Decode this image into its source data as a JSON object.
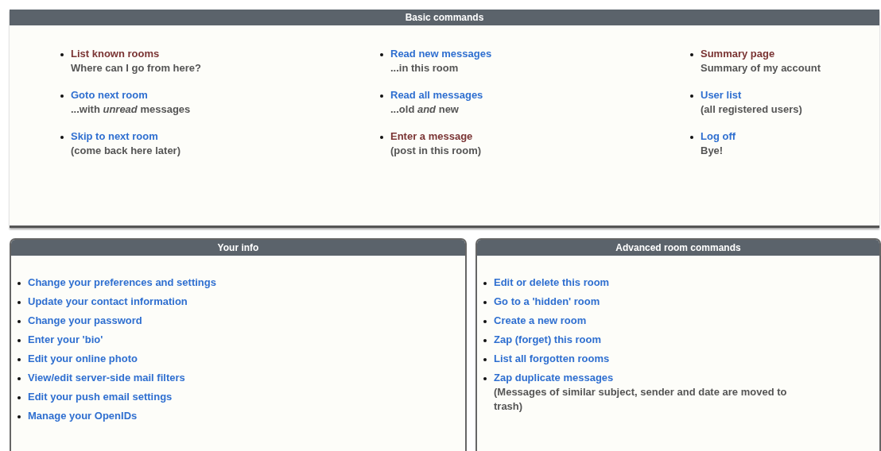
{
  "panels": [
    {
      "title": "Basic commands",
      "kind": "columns",
      "columns": [
        [
          {
            "link": "List known rooms",
            "visited": true,
            "description": "Where can I go from here?"
          },
          {
            "link": "Goto next room",
            "visited": false,
            "description": "...with *unread* messages"
          },
          {
            "link": "Skip to next room",
            "visited": false,
            "description": "(come back here later)"
          }
        ],
        [
          {
            "link": "Read new messages",
            "visited": false,
            "description": "...in this room"
          },
          {
            "link": "Read all messages",
            "visited": false,
            "description": "...old *and* new"
          },
          {
            "link": "Enter a message",
            "visited": true,
            "description": "(post in this room)"
          }
        ],
        [
          {
            "link": "Summary page",
            "visited": true,
            "description": "Summary of my account"
          },
          {
            "link": "User list",
            "visited": false,
            "description": "(all registered users)"
          },
          {
            "link": "Log off",
            "visited": false,
            "description": "Bye!"
          }
        ]
      ]
    },
    {
      "title": "Your info",
      "kind": "list",
      "items": [
        {
          "link": "Change your preferences and settings",
          "visited": false
        },
        {
          "link": "Update your contact information",
          "visited": false
        },
        {
          "link": "Change your password",
          "visited": false
        },
        {
          "link": "Enter your 'bio'",
          "visited": false
        },
        {
          "link": "Edit your online photo",
          "visited": false
        },
        {
          "link": "View/edit server-side mail filters",
          "visited": false
        },
        {
          "link": "Edit your push email settings",
          "visited": false
        },
        {
          "link": "Manage your OpenIDs",
          "visited": false
        }
      ]
    },
    {
      "title": "Advanced room commands",
      "kind": "list",
      "items": [
        {
          "link": "Edit or delete this room",
          "visited": false
        },
        {
          "link": "Go to a 'hidden' room",
          "visited": false
        },
        {
          "link": "Create a new room",
          "visited": false
        },
        {
          "link": "Zap (forget) this room",
          "visited": false
        },
        {
          "link": "List all forgotten rooms",
          "visited": false
        },
        {
          "link": "Zap duplicate messages",
          "visited": false,
          "description": "(Messages of similar subject, sender and date are moved to trash)"
        }
      ]
    }
  ]
}
